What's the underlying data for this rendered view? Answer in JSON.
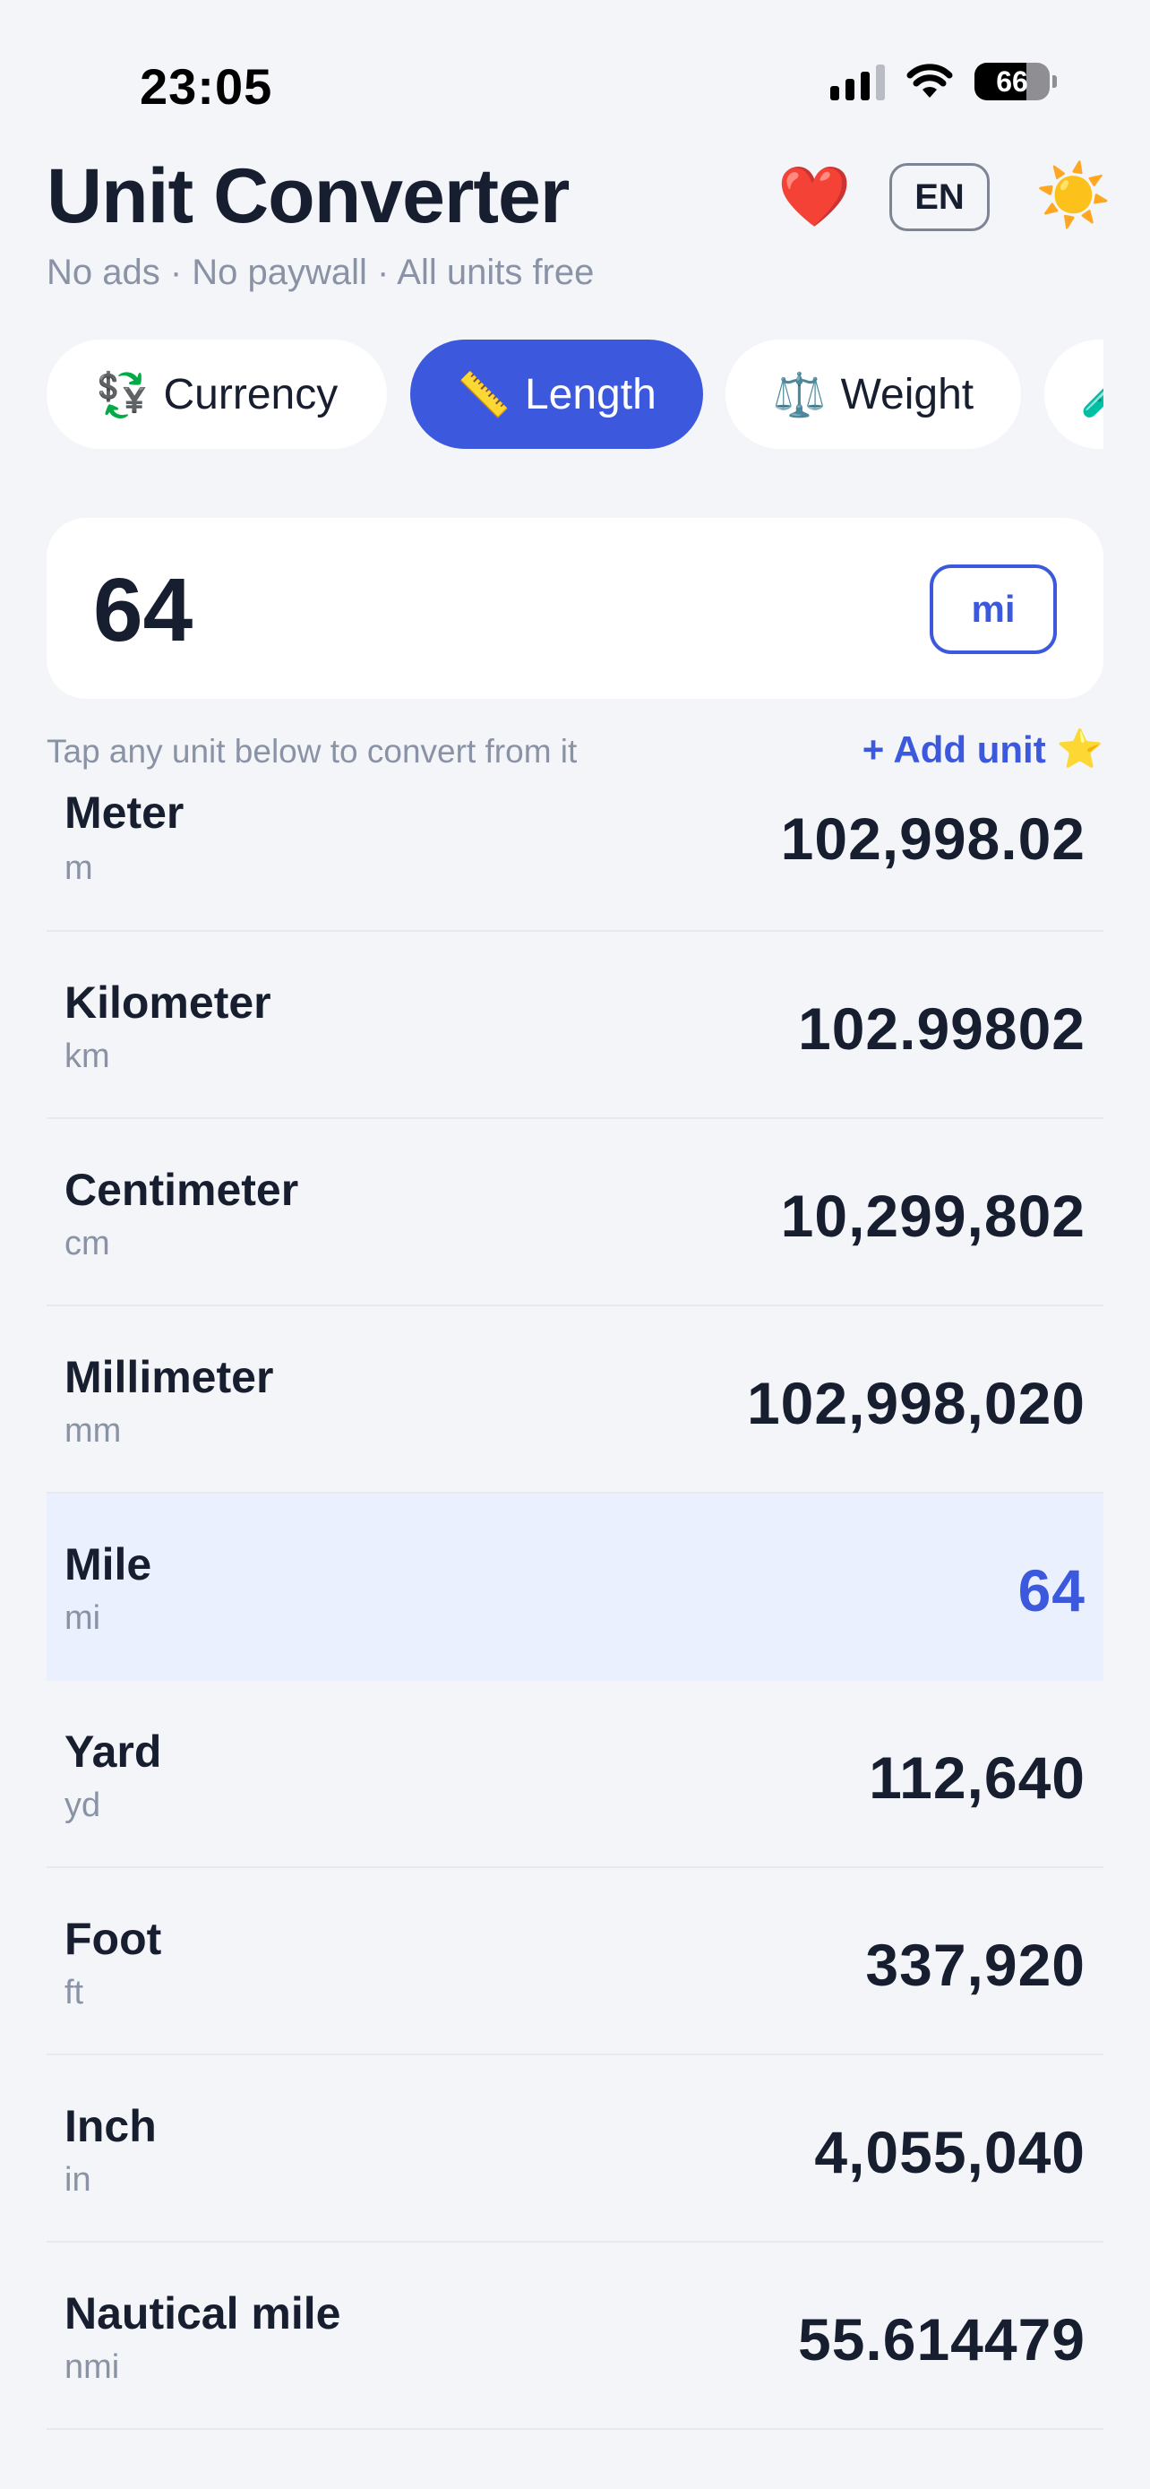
{
  "status_bar": {
    "time": "23:05",
    "battery": "66"
  },
  "header": {
    "title": "Unit Converter",
    "subtitle": "No ads · No paywall · All units free",
    "heart_glyph": "❤️",
    "language": "EN",
    "theme_glyph": "☀️"
  },
  "tabs": [
    {
      "icon": "💱",
      "label": "Currency",
      "active": false
    },
    {
      "icon": "📏",
      "label": "Length",
      "active": true
    },
    {
      "icon": "⚖️",
      "label": "Weight",
      "active": false
    },
    {
      "icon": "🧪",
      "label": "",
      "active": false
    }
  ],
  "input": {
    "value": "64",
    "unit": "mi"
  },
  "hint": "Tap any unit below to convert from it",
  "add_unit": {
    "label": "+ Add unit",
    "icon": "⭐"
  },
  "units": [
    {
      "name": "Meter",
      "abbr": "m",
      "value": "102,998.02",
      "selected": false
    },
    {
      "name": "Kilometer",
      "abbr": "km",
      "value": "102.99802",
      "selected": false
    },
    {
      "name": "Centimeter",
      "abbr": "cm",
      "value": "10,299,802",
      "selected": false
    },
    {
      "name": "Millimeter",
      "abbr": "mm",
      "value": "102,998,020",
      "selected": false
    },
    {
      "name": "Mile",
      "abbr": "mi",
      "value": "64",
      "selected": true
    },
    {
      "name": "Yard",
      "abbr": "yd",
      "value": "112,640",
      "selected": false
    },
    {
      "name": "Foot",
      "abbr": "ft",
      "value": "337,920",
      "selected": false
    },
    {
      "name": "Inch",
      "abbr": "in",
      "value": "4,055,040",
      "selected": false
    },
    {
      "name": "Nautical mile",
      "abbr": "nmi",
      "value": "55.614479",
      "selected": false
    }
  ],
  "colors": {
    "accent": "#3c59dd",
    "background": "#f3f5f8",
    "selected_row": "#ebf0fe",
    "text": "#171e2f",
    "muted": "#8a93a5"
  }
}
